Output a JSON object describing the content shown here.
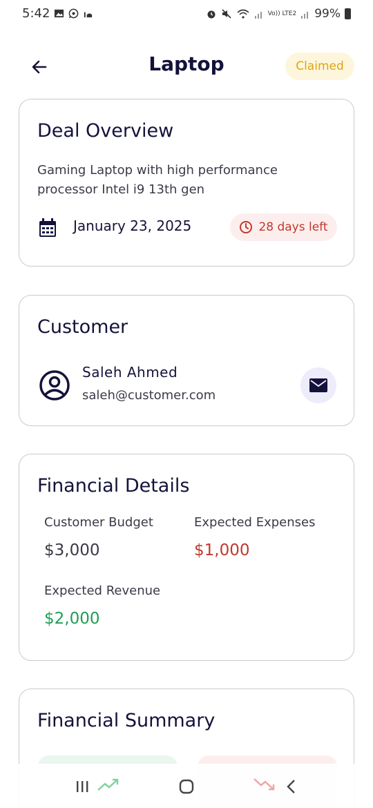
{
  "status_bar": {
    "time": "5:42",
    "battery": "99%",
    "network": "Vo)) LTE2"
  },
  "header": {
    "title": "Laptop",
    "status": "Claimed",
    "back_icon": "arrow-left-icon"
  },
  "deal_overview": {
    "title": "Deal Overview",
    "description": "Gaming Laptop with high performance processor Intel i9 13th gen",
    "date": "January 23, 2025",
    "days_left": "28 days left"
  },
  "customer": {
    "title": "Customer",
    "name": "Saleh Ahmed",
    "email": "saleh@customer.com"
  },
  "financial_details": {
    "title": "Financial Details",
    "budget_label": "Customer Budget",
    "budget_value": "$3,000",
    "expenses_label": "Expected Expenses",
    "expenses_value": "$1,000",
    "revenue_label": "Expected Revenue",
    "revenue_value": "$2,000"
  },
  "financial_summary": {
    "title": "Financial Summary"
  },
  "colors": {
    "primary": "#14123a",
    "claimed": "#e0a315",
    "red": "#c0392b",
    "green": "#1e9e55"
  }
}
